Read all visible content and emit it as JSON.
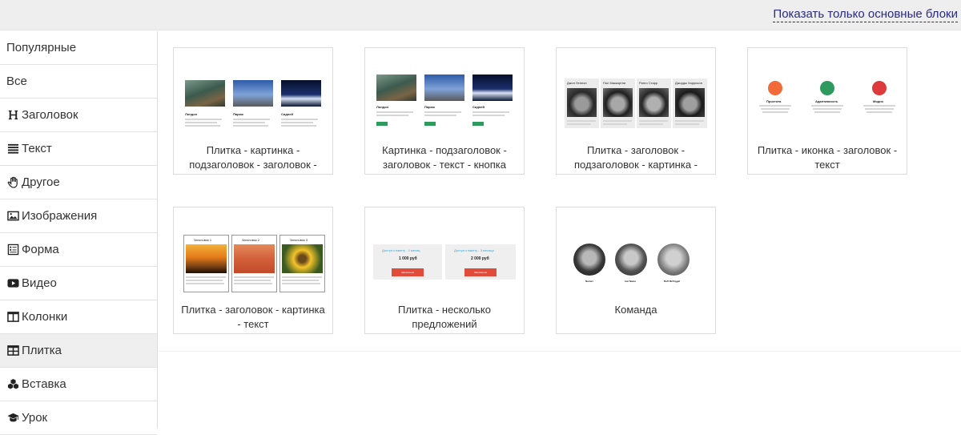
{
  "topbar": {
    "toggle_label": "Показать только основные блоки"
  },
  "sidebar": {
    "items": [
      {
        "label": "Популярные",
        "icon": "none"
      },
      {
        "label": "Все",
        "icon": "none"
      },
      {
        "label": "Заголовок",
        "icon": "heading-icon"
      },
      {
        "label": "Текст",
        "icon": "text-lines-icon"
      },
      {
        "label": "Другое",
        "icon": "hand-icon"
      },
      {
        "label": "Изображения",
        "icon": "image-icon"
      },
      {
        "label": "Форма",
        "icon": "form-icon"
      },
      {
        "label": "Видео",
        "icon": "video-icon"
      },
      {
        "label": "Колонки",
        "icon": "columns-icon"
      },
      {
        "label": "Плитка",
        "icon": "tiles-icon",
        "active": true
      },
      {
        "label": "Вставка",
        "icon": "cubes-icon"
      },
      {
        "label": "Урок",
        "icon": "graduation-cap-icon"
      }
    ]
  },
  "cards": [
    {
      "label": "Плитка - картинка - подзаголовок - заголовок -"
    },
    {
      "label": "Картинка - подзаголовок - заголовок - текст - кнопка"
    },
    {
      "label": "Плитка - заголовок - подзаголовок - картинка -"
    },
    {
      "label": "Плитка - иконка - заголовок - текст"
    },
    {
      "label": "Плитка - заголовок - картинка - текст"
    },
    {
      "label": "Плитка - несколько предложений"
    },
    {
      "label": "Команда"
    }
  ],
  "thumbs": {
    "cities": [
      "Лондон",
      "Париж",
      "Сидней"
    ],
    "people": [
      "Джон Леннон",
      "Пол Маккартни",
      "Ринго Старр",
      "Джордж Харрисон"
    ],
    "features": [
      "Простота",
      "Адаптивность",
      "Модно"
    ],
    "tile_headers": [
      "Заголовок 1",
      "Заголовок 2",
      "Заголовок 3"
    ],
    "offers": [
      {
        "title": "Доступ к пакету - 1 месяц",
        "price": "1 000 руб",
        "button": "Записаться"
      },
      {
        "title": "Доступ к пакету - 3 месяца",
        "price": "2 000 руб",
        "button": "Записаться"
      }
    ],
    "team": [
      "Name1",
      "Ivel Name",
      "Ruff Mcfriggel"
    ]
  },
  "colors": {
    "accent_link": "#2a2a86",
    "active_bg": "#efefef",
    "green_button": "#2e9a5e",
    "red_button": "#e14b3a",
    "feature_orange": "#f06a3a",
    "feature_green": "#2e9a5e",
    "feature_red": "#dd3b3b"
  }
}
